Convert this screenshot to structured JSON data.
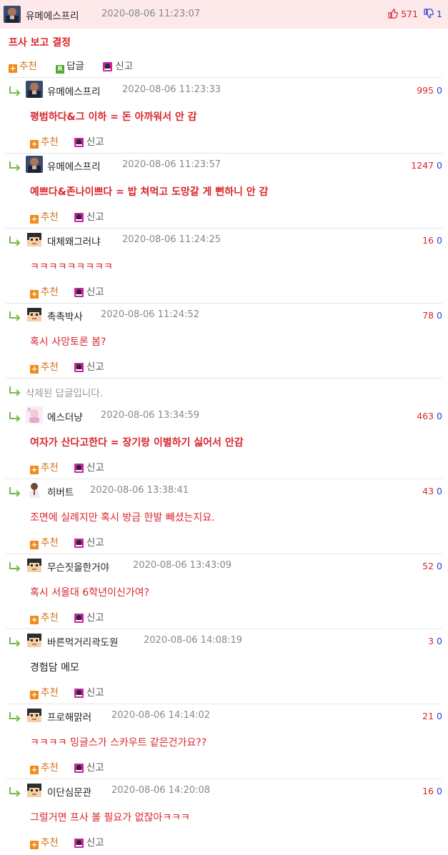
{
  "post": {
    "nickname": "유메에스프리",
    "date": "2020-08-06 11:23:07",
    "up": "571",
    "down": "1",
    "body": "프사 보고 결정",
    "actions": {
      "recommend": "추천",
      "reply": "답글",
      "report": "신고"
    }
  },
  "replies": [
    {
      "nickname": "유메에스프리",
      "date": "2020-08-06 11:23:33",
      "up": "995",
      "down": "0",
      "body": "평범하다&그 이하 = 돈 아까워서 안 감",
      "style": "bold",
      "avatar": "photo"
    },
    {
      "nickname": "유메에스프리",
      "date": "2020-08-06 11:23:57",
      "up": "1247",
      "down": "0",
      "body": "예쁘다&존나이쁘다 = 밥 쳐먹고 도망갈 게 뻔하니 안 감",
      "style": "bold",
      "avatar": "photo"
    },
    {
      "nickname": "대체왜그러냐",
      "date": "2020-08-06 11:24:25",
      "up": "16",
      "down": "0",
      "body": "ㅋㅋㅋㅋㅋㅋㅋㅋㅋ",
      "style": "red",
      "avatar": "pixel"
    },
    {
      "nickname": "촉촉박사",
      "date": "2020-08-06 11:24:52",
      "up": "78",
      "down": "0",
      "body": "혹시 사망토론 봄?",
      "style": "red",
      "avatar": "pixel"
    },
    {
      "deleted": "삭제된 답글입니다."
    },
    {
      "nickname": "에스더냥",
      "date": "2020-08-06 13:34:59",
      "up": "463",
      "down": "0",
      "body": "여자가 산다고한다 = 장기랑 이별하기 싫어서 안감",
      "style": "bold",
      "avatar": "pink"
    },
    {
      "nickname": "히버트",
      "date": "2020-08-06 13:38:41",
      "up": "43",
      "down": "0",
      "body": "조면에 실례지만 혹시 방금 한발 빼셨는지요.",
      "style": "red",
      "avatar": "doctor"
    },
    {
      "nickname": "무슨짓을한거야",
      "date": "2020-08-06 13:43:09",
      "up": "52",
      "down": "0",
      "body": "혹시 서울대 6학년이신가여?",
      "style": "red",
      "avatar": "pixel"
    },
    {
      "nickname": "바른먹거리곽도원",
      "date": "2020-08-06 14:08:19",
      "up": "3",
      "down": "0",
      "body": "경험담 메모",
      "style": "dark",
      "avatar": "pixel"
    },
    {
      "nickname": "프로해맑러",
      "date": "2020-08-06 14:14:02",
      "up": "21",
      "down": "0",
      "body": "ㅋㅋㅋㅋ 밍글스가 스카우트 같은건가요??",
      "style": "red",
      "avatar": "pixel"
    },
    {
      "nickname": "이단심문관",
      "date": "2020-08-06 14:20:08",
      "up": "16",
      "down": "0",
      "body": "그럴거면 프사 볼 필요가 없잖아ㅋㅋㅋ",
      "style": "red",
      "avatar": "pixel"
    }
  ],
  "reply_actions": {
    "recommend": "추천",
    "report": "신고"
  },
  "colors": {
    "accent_red": "#d9262d",
    "down_blue": "#2b3fd4",
    "top_bg": "#fde8ea",
    "recommend_orange": "#f08a16"
  }
}
